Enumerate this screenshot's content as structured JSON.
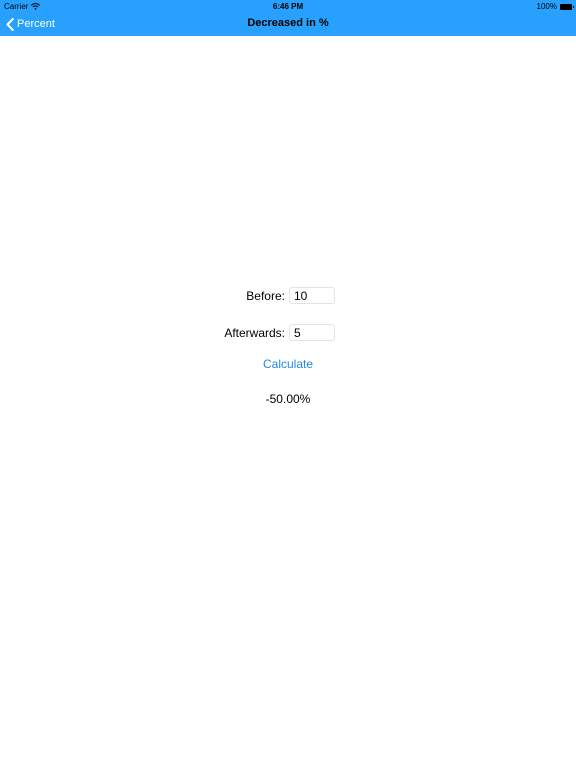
{
  "status_bar": {
    "carrier": "Carrier",
    "wifi_icon": "wifi-icon",
    "time": "6:46 PM",
    "battery_percent": "100%",
    "battery_icon": "battery-icon"
  },
  "nav": {
    "back_label": "Percent",
    "back_icon": "chevron-left-icon",
    "title": "Decreased in %"
  },
  "form": {
    "before_label": "Before:",
    "before_value": "10",
    "after_label": "Afterwards:",
    "after_value": "5",
    "calculate_label": "Calculate",
    "result": "-50.00%"
  },
  "colors": {
    "nav_background": "#27A1FD",
    "link": "#1E88E5",
    "text": "#000000",
    "background": "#FFFFFF"
  }
}
